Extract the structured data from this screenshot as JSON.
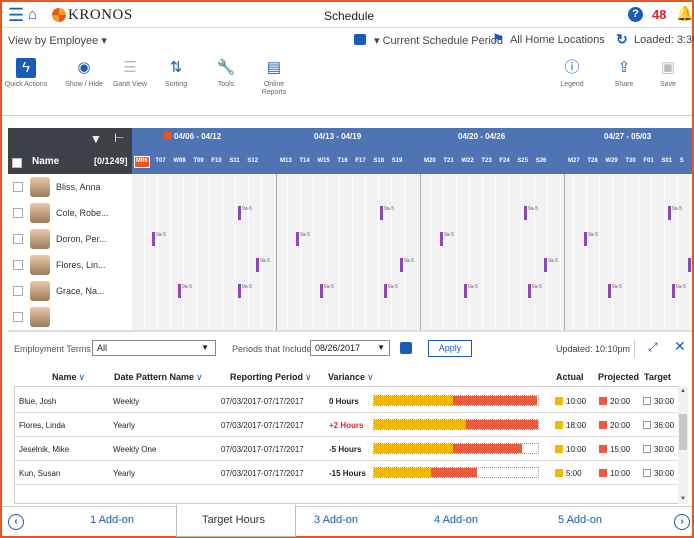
{
  "topbar": {
    "brand": "KRONOS",
    "title": "Schedule",
    "help_icon": "?",
    "notification_count": "48"
  },
  "view": {
    "view_by": "View by Employee ▾",
    "schedule_period": "▾ Current Schedule Period",
    "locations": "All Home Locations",
    "loaded": "Loaded: 3:30p"
  },
  "toolbar": {
    "items": [
      {
        "label": "Quick Actions",
        "icon": "lightning-icon"
      },
      {
        "label": "Show / Hide",
        "icon": "eye-icon"
      },
      {
        "label": "Gantt View",
        "icon": "gantt-icon"
      },
      {
        "label": "Sorting",
        "icon": "sort-icon"
      },
      {
        "label": "Tools",
        "icon": "wrench-icon"
      },
      {
        "label": "Online Reports",
        "icon": "report-icon"
      },
      {
        "label": "Legend",
        "icon": "info-icon"
      },
      {
        "label": "Share",
        "icon": "share-icon"
      },
      {
        "label": "Save",
        "icon": "save-icon"
      }
    ]
  },
  "schedule": {
    "name_header": "Name",
    "count": "[0/1249]",
    "weeks": [
      "04/06 - 04/12",
      "04/13 - 04/19",
      "04/20 - 04/26",
      "04/27 - 05/03"
    ],
    "days": [
      "M06 T07 W08 T09 F10 S11 S12",
      "M13 T14 W15 T16 F17 S18 S19",
      "M20 T21 W22 T23 F24 S25 S26",
      "M27 T28 W29 T30 F01 S01 S"
    ],
    "employees": [
      "Bliss, Anna",
      "Cole, Robe...",
      "Doron, Per...",
      "Flores, Lin...",
      "Grace, Na..."
    ],
    "shift_label": "9a-5"
  },
  "panel": {
    "employment_terms_label": "Employment Terms",
    "employment_terms_value": "All",
    "periods_label": "Periods that Include",
    "periods_value": "08/26/2017",
    "apply_label": "Apply",
    "updated": "Updated: 10:10pm",
    "columns": {
      "name": "Name",
      "date_pattern": "Date Pattern Name",
      "reporting_period": "Reporting Period",
      "variance": "Variance",
      "actual": "Actual",
      "projected": "Projected",
      "target": "Target"
    },
    "rows": [
      {
        "name": "Blue, Josh",
        "pattern": "Weekly",
        "period": "07/03/2017-07/17/2017",
        "variance": "0 Hours",
        "actual": "10:00",
        "projected": "20:00",
        "target": "30:00",
        "actual_frac": 0.48,
        "projected_frac": 0.99,
        "variance_sign": "zero"
      },
      {
        "name": "Flores, Linda",
        "pattern": "Yearly",
        "period": "07/03/2017-07/17/2017",
        "variance": "+2 Hours",
        "actual": "18:00",
        "projected": "20:00",
        "target": "36:00",
        "actual_frac": 0.56,
        "projected_frac": 1.0,
        "variance_sign": "pos"
      },
      {
        "name": "Jeselnik, Mike",
        "pattern": "Weekly One",
        "period": "07/03/2017-07/17/2017",
        "variance": "-5 Hours",
        "actual": "10:00",
        "projected": "15:00",
        "target": "30:00",
        "actual_frac": 0.48,
        "projected_frac": 0.9,
        "variance_sign": "neg"
      },
      {
        "name": "Kun, Susan",
        "pattern": "Yearly",
        "period": "07/03/2017-07/17/2017",
        "variance": "-15 Hours",
        "actual": "5:00",
        "projected": "10:00",
        "target": "30:00",
        "actual_frac": 0.35,
        "projected_frac": 0.63,
        "variance_sign": "neg"
      }
    ]
  },
  "tabs": [
    "1 Add-on",
    "Target Hours",
    "3 Add-on",
    "4 Add-on",
    "5 Add-on"
  ],
  "colors": {
    "brand_blue": "#1a5bb8",
    "alert_red": "#e02424",
    "actual_yellow": "#f5b800",
    "projected_red": "#ee5a3c",
    "shift_purple": "#8c49b6"
  }
}
